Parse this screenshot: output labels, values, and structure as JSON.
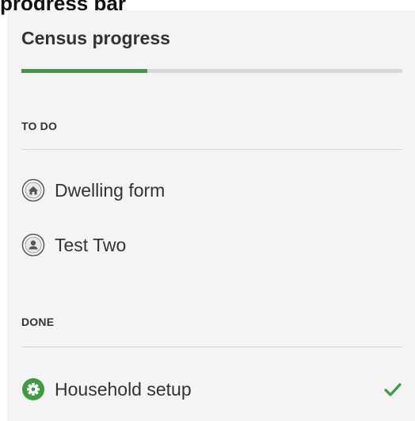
{
  "caption": "progress bar",
  "sidebar": {
    "title": "Census progress",
    "progress_fraction": 0.33,
    "todo_heading": "TO DO",
    "todo_items": [
      {
        "label": "Dwelling form",
        "icon": "home-icon"
      },
      {
        "label": "Test Two",
        "icon": "person-icon"
      }
    ],
    "done_heading": "DONE",
    "done_items": [
      {
        "label": "Household setup",
        "icon": "gear-icon",
        "status_icon": "checkmark-icon"
      }
    ]
  },
  "colors": {
    "accent_green": "#3c9c3e",
    "panel_background": "#f4f4f4",
    "track_gray": "#d8d8d8",
    "text": "#333333"
  }
}
